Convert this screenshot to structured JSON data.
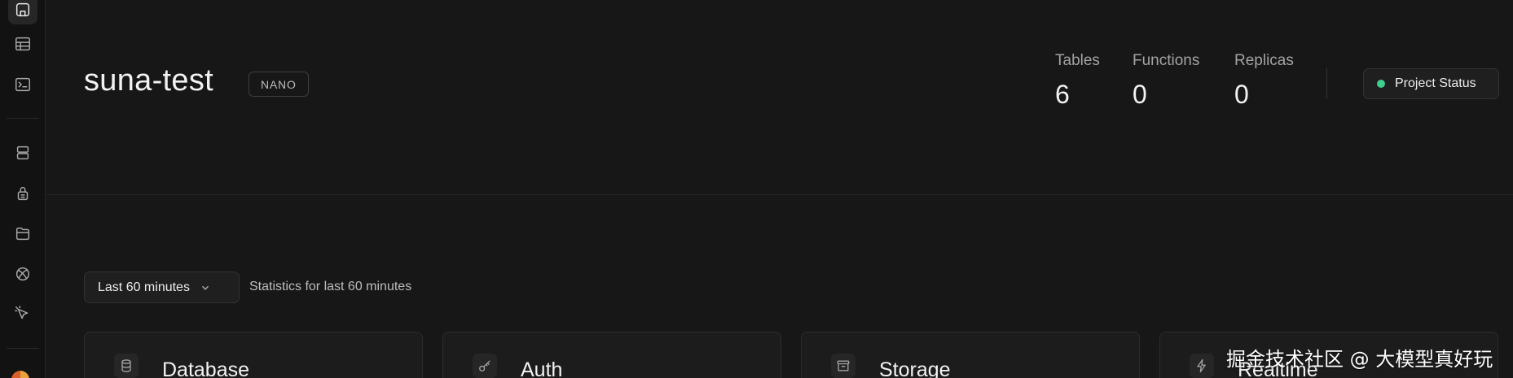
{
  "project": {
    "name": "suna-test",
    "plan_badge": "NANO"
  },
  "stats": [
    {
      "label": "Tables",
      "value": "6"
    },
    {
      "label": "Functions",
      "value": "0"
    },
    {
      "label": "Replicas",
      "value": "0"
    }
  ],
  "status_button": {
    "label": "Project Status",
    "dot_color": "#3ecf8e"
  },
  "range": {
    "selected": "Last 60 minutes",
    "caption": "Statistics for last 60 minutes"
  },
  "cards": [
    {
      "title": "Database",
      "icon": "database-icon"
    },
    {
      "title": "Auth",
      "icon": "key-icon"
    },
    {
      "title": "Storage",
      "icon": "archive-icon"
    },
    {
      "title": "Realtime",
      "icon": "bolt-icon"
    }
  ],
  "sidebar_icons": [
    "home-icon",
    "table-editor-icon",
    "sql-editor-icon",
    "database-icon",
    "auth-icon",
    "storage-icon",
    "realtime-icon",
    "edge-functions-icon"
  ],
  "watermark": "掘金技术社区 @ 大模型真好玩"
}
